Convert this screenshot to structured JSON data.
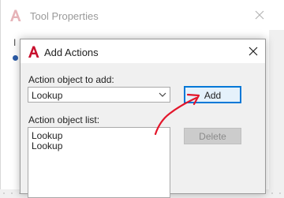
{
  "background_window": {
    "title": "Tool Properties",
    "clipped_label": "I",
    "icons": {
      "app": "autocad-logo-icon",
      "close": "close-icon"
    }
  },
  "dialog": {
    "title": "Add Actions",
    "icons": {
      "app": "autocad-logo-icon",
      "close": "close-icon"
    },
    "action_object_label": "Action object to add:",
    "action_object_value": "Lookup",
    "add_label": "Add",
    "list_label": "Action object list:",
    "list_items": [
      "Lookup",
      "Lookup"
    ],
    "delete_label": "Delete"
  },
  "annotation": {
    "arrow_color": "#e3162b",
    "points_to": "add-button"
  },
  "colors": {
    "accent": "#0078d7",
    "logo_red": "#c8102e",
    "dialog_bg": "#f0f0f0"
  }
}
